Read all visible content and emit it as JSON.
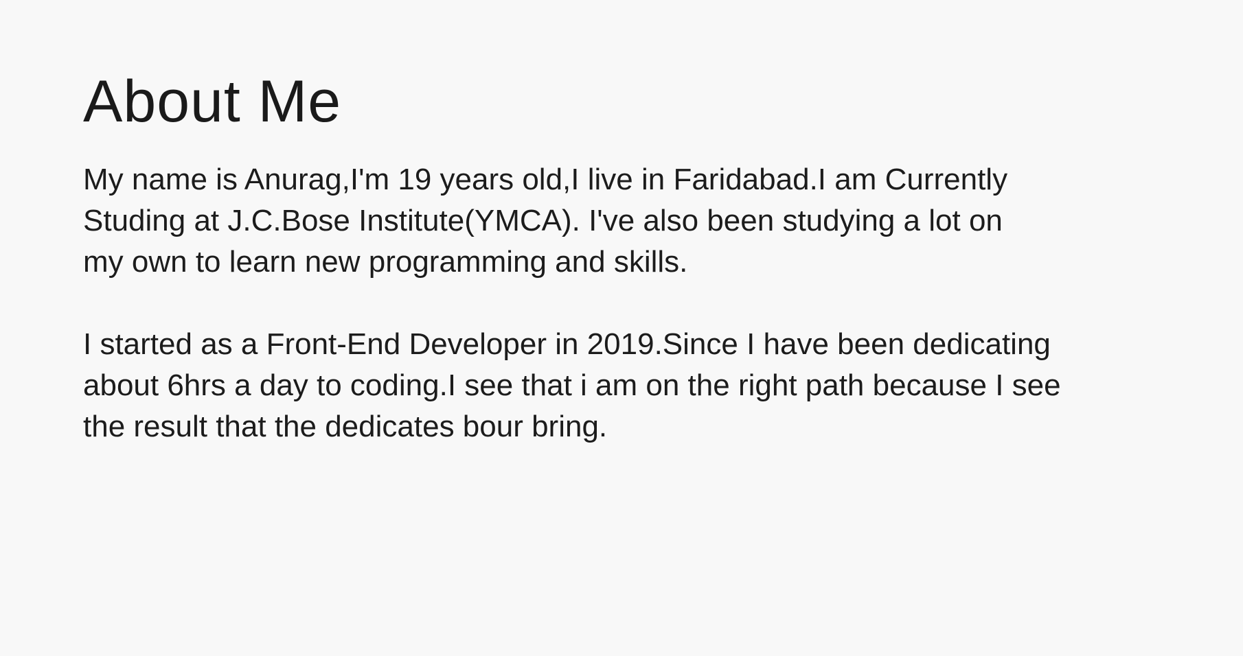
{
  "about": {
    "title": "About Me",
    "paragraphs": [
      {
        "lines": [
          "My name is Anurag,I'm 19 years old,I live in Faridabad.I am Currently",
          "Studing at J.C.Bose Institute(YMCA). I've also been studying a lot on",
          "my own to learn new programming and skills."
        ]
      },
      {
        "lines": [
          "I started as a Front-End Developer in 2019.Since I have been dedicating",
          "about 6hrs a day to coding.I see that i am on the right path because I see",
          "the result that the dedicates bour bring."
        ]
      }
    ]
  }
}
